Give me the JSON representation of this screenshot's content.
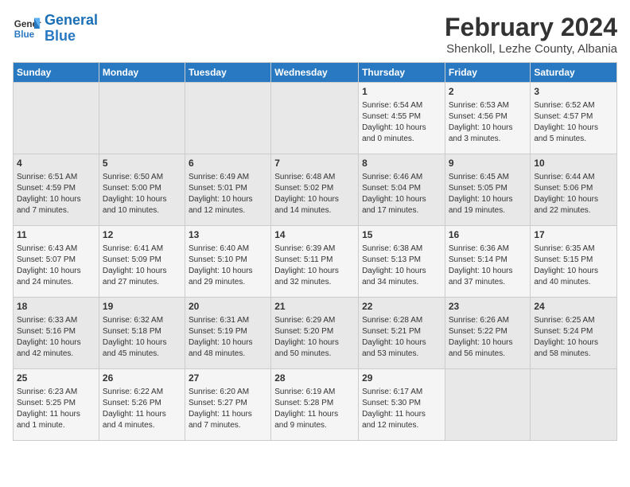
{
  "logo": {
    "line1": "General",
    "line2": "Blue"
  },
  "title": "February 2024",
  "subtitle": "Shenkoll, Lezhe County, Albania",
  "weekdays": [
    "Sunday",
    "Monday",
    "Tuesday",
    "Wednesday",
    "Thursday",
    "Friday",
    "Saturday"
  ],
  "weeks": [
    [
      {
        "day": "",
        "info": ""
      },
      {
        "day": "",
        "info": ""
      },
      {
        "day": "",
        "info": ""
      },
      {
        "day": "",
        "info": ""
      },
      {
        "day": "1",
        "info": "Sunrise: 6:54 AM\nSunset: 4:55 PM\nDaylight: 10 hours\nand 0 minutes."
      },
      {
        "day": "2",
        "info": "Sunrise: 6:53 AM\nSunset: 4:56 PM\nDaylight: 10 hours\nand 3 minutes."
      },
      {
        "day": "3",
        "info": "Sunrise: 6:52 AM\nSunset: 4:57 PM\nDaylight: 10 hours\nand 5 minutes."
      }
    ],
    [
      {
        "day": "4",
        "info": "Sunrise: 6:51 AM\nSunset: 4:59 PM\nDaylight: 10 hours\nand 7 minutes."
      },
      {
        "day": "5",
        "info": "Sunrise: 6:50 AM\nSunset: 5:00 PM\nDaylight: 10 hours\nand 10 minutes."
      },
      {
        "day": "6",
        "info": "Sunrise: 6:49 AM\nSunset: 5:01 PM\nDaylight: 10 hours\nand 12 minutes."
      },
      {
        "day": "7",
        "info": "Sunrise: 6:48 AM\nSunset: 5:02 PM\nDaylight: 10 hours\nand 14 minutes."
      },
      {
        "day": "8",
        "info": "Sunrise: 6:46 AM\nSunset: 5:04 PM\nDaylight: 10 hours\nand 17 minutes."
      },
      {
        "day": "9",
        "info": "Sunrise: 6:45 AM\nSunset: 5:05 PM\nDaylight: 10 hours\nand 19 minutes."
      },
      {
        "day": "10",
        "info": "Sunrise: 6:44 AM\nSunset: 5:06 PM\nDaylight: 10 hours\nand 22 minutes."
      }
    ],
    [
      {
        "day": "11",
        "info": "Sunrise: 6:43 AM\nSunset: 5:07 PM\nDaylight: 10 hours\nand 24 minutes."
      },
      {
        "day": "12",
        "info": "Sunrise: 6:41 AM\nSunset: 5:09 PM\nDaylight: 10 hours\nand 27 minutes."
      },
      {
        "day": "13",
        "info": "Sunrise: 6:40 AM\nSunset: 5:10 PM\nDaylight: 10 hours\nand 29 minutes."
      },
      {
        "day": "14",
        "info": "Sunrise: 6:39 AM\nSunset: 5:11 PM\nDaylight: 10 hours\nand 32 minutes."
      },
      {
        "day": "15",
        "info": "Sunrise: 6:38 AM\nSunset: 5:13 PM\nDaylight: 10 hours\nand 34 minutes."
      },
      {
        "day": "16",
        "info": "Sunrise: 6:36 AM\nSunset: 5:14 PM\nDaylight: 10 hours\nand 37 minutes."
      },
      {
        "day": "17",
        "info": "Sunrise: 6:35 AM\nSunset: 5:15 PM\nDaylight: 10 hours\nand 40 minutes."
      }
    ],
    [
      {
        "day": "18",
        "info": "Sunrise: 6:33 AM\nSunset: 5:16 PM\nDaylight: 10 hours\nand 42 minutes."
      },
      {
        "day": "19",
        "info": "Sunrise: 6:32 AM\nSunset: 5:18 PM\nDaylight: 10 hours\nand 45 minutes."
      },
      {
        "day": "20",
        "info": "Sunrise: 6:31 AM\nSunset: 5:19 PM\nDaylight: 10 hours\nand 48 minutes."
      },
      {
        "day": "21",
        "info": "Sunrise: 6:29 AM\nSunset: 5:20 PM\nDaylight: 10 hours\nand 50 minutes."
      },
      {
        "day": "22",
        "info": "Sunrise: 6:28 AM\nSunset: 5:21 PM\nDaylight: 10 hours\nand 53 minutes."
      },
      {
        "day": "23",
        "info": "Sunrise: 6:26 AM\nSunset: 5:22 PM\nDaylight: 10 hours\nand 56 minutes."
      },
      {
        "day": "24",
        "info": "Sunrise: 6:25 AM\nSunset: 5:24 PM\nDaylight: 10 hours\nand 58 minutes."
      }
    ],
    [
      {
        "day": "25",
        "info": "Sunrise: 6:23 AM\nSunset: 5:25 PM\nDaylight: 11 hours\nand 1 minute."
      },
      {
        "day": "26",
        "info": "Sunrise: 6:22 AM\nSunset: 5:26 PM\nDaylight: 11 hours\nand 4 minutes."
      },
      {
        "day": "27",
        "info": "Sunrise: 6:20 AM\nSunset: 5:27 PM\nDaylight: 11 hours\nand 7 minutes."
      },
      {
        "day": "28",
        "info": "Sunrise: 6:19 AM\nSunset: 5:28 PM\nDaylight: 11 hours\nand 9 minutes."
      },
      {
        "day": "29",
        "info": "Sunrise: 6:17 AM\nSunset: 5:30 PM\nDaylight: 11 hours\nand 12 minutes."
      },
      {
        "day": "",
        "info": ""
      },
      {
        "day": "",
        "info": ""
      }
    ]
  ]
}
